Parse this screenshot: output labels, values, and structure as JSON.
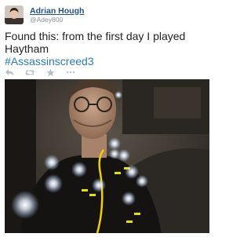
{
  "author": {
    "name": "Adrian Hough",
    "handle": "@Adey800"
  },
  "tweet": {
    "text": "Found this: from the first day I played Haytham",
    "hashtag": "#Assassinscreed3"
  },
  "actions": [
    "reply-icon",
    "retweet-icon",
    "favorite-icon",
    "more-icon"
  ],
  "colors": {
    "name": "#1f4f8a",
    "hashtag": "#2b7bb9",
    "action_icons": "#b8c0c8"
  }
}
